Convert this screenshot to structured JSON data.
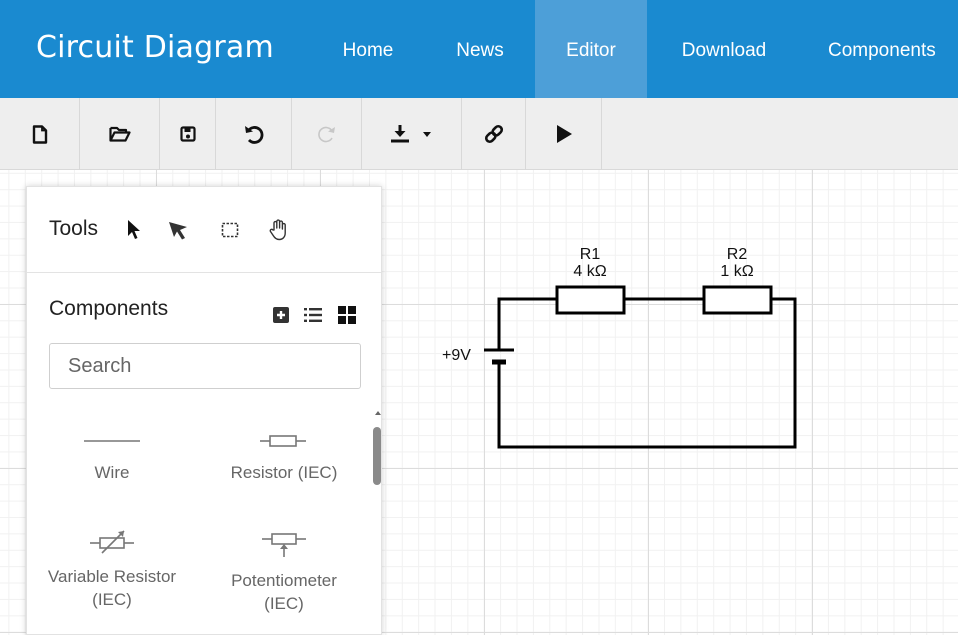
{
  "app": {
    "title": "Circuit Diagram"
  },
  "nav": {
    "items": [
      {
        "label": "Home",
        "active": false
      },
      {
        "label": "News",
        "active": false
      },
      {
        "label": "Editor",
        "active": true
      },
      {
        "label": "Download",
        "active": false
      },
      {
        "label": "Components",
        "active": false
      }
    ]
  },
  "toolbar": {
    "buttons": [
      {
        "icon": "new-file-icon"
      },
      {
        "icon": "open-folder-icon"
      },
      {
        "icon": "save-icon"
      },
      {
        "icon": "undo-icon"
      },
      {
        "icon": "redo-icon",
        "disabled": true
      },
      {
        "icon": "download-dropdown-icon"
      },
      {
        "icon": "link-icon"
      },
      {
        "icon": "play-icon"
      }
    ]
  },
  "panel": {
    "tools": {
      "label": "Tools",
      "icons": [
        "pointer-icon",
        "select-arrow-icon",
        "selection-box-icon",
        "pan-hand-icon"
      ]
    },
    "components": {
      "label": "Components",
      "view_icons": [
        "add-icon",
        "list-view-icon",
        "grid-view-icon"
      ],
      "search": {
        "placeholder": "Search",
        "value": ""
      },
      "items": [
        {
          "label": "Wire",
          "icon": "wire-icon"
        },
        {
          "label": "Resistor (IEC)",
          "icon": "resistor-icon"
        },
        {
          "label": "Variable Resistor",
          "label_line2": "(IEC)",
          "icon": "variable-resistor-icon"
        },
        {
          "label": "Potentiometer",
          "label_line2": "(IEC)",
          "icon": "potentiometer-icon"
        }
      ]
    }
  },
  "circuit": {
    "battery": {
      "label": "+9V"
    },
    "resistors": [
      {
        "name": "R1",
        "value": "4 kΩ"
      },
      {
        "name": "R2",
        "value": "1 kΩ"
      }
    ]
  },
  "colors": {
    "nav_bg": "#1a8ad0",
    "nav_active": "#4d9fd8",
    "toolbar_bg": "#eeeeee"
  }
}
